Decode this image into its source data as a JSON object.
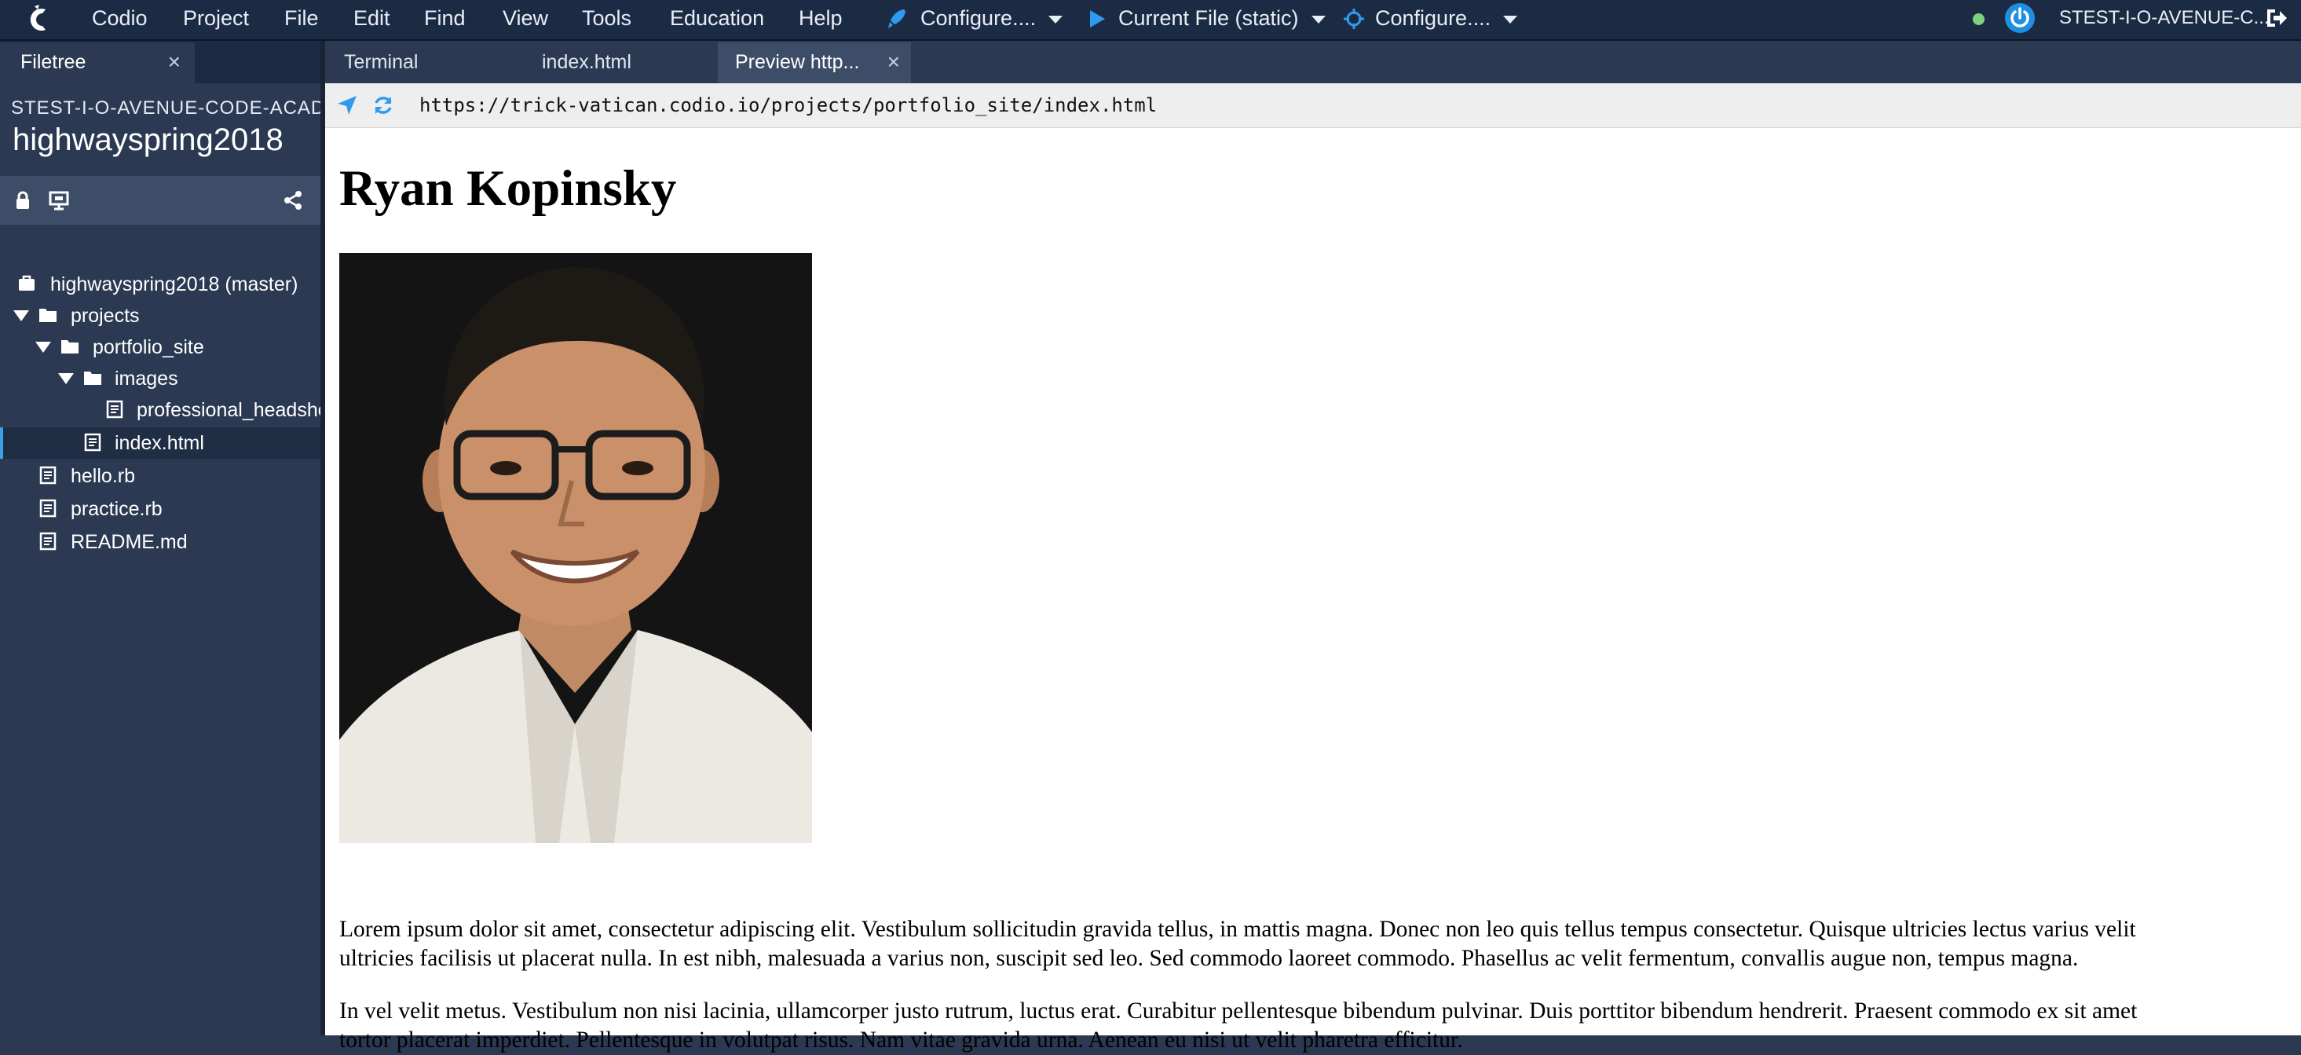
{
  "menubar": {
    "items": [
      "Codio",
      "Project",
      "File",
      "Edit",
      "Find",
      "View",
      "Tools",
      "Education",
      "Help"
    ],
    "configure_deploy": "Configure....",
    "run_target": "Current File (static)",
    "configure_preview": "Configure....",
    "user": "STEST-I-O-AVENUE-C...",
    "status_color": "#7ed27e",
    "accent_color": "#1f8fe0"
  },
  "sidebar": {
    "tab_label": "Filetree",
    "close_glyph": "×",
    "owner": "STEST-I-O-AVENUE-CODE-ACADEM",
    "project_name": "highwayspring2018",
    "tree": [
      {
        "label": "highwayspring2018 (master)",
        "icon": "briefcase-icon"
      },
      {
        "label": "projects",
        "icon": "folder-icon",
        "expanded": true
      },
      {
        "label": "portfolio_site",
        "icon": "folder-icon",
        "expanded": true
      },
      {
        "label": "images",
        "icon": "folder-icon",
        "expanded": true
      },
      {
        "label": "professional_headshot",
        "icon": "file-icon"
      },
      {
        "label": "index.html",
        "icon": "file-icon",
        "selected": true
      },
      {
        "label": "hello.rb",
        "icon": "file-icon"
      },
      {
        "label": "practice.rb",
        "icon": "file-icon"
      },
      {
        "label": "README.md",
        "icon": "file-icon"
      }
    ]
  },
  "tabs": [
    {
      "label": "Terminal"
    },
    {
      "label": "index.html"
    },
    {
      "label": "Preview http...",
      "active": true,
      "close": "×"
    }
  ],
  "preview": {
    "url": "https://trick-vatican.codio.io/projects/portfolio_site/index.html",
    "heading": "Ryan Kopinsky",
    "paragraph1_line1": "Lorem ipsum dolor sit amet, consectetur adipiscing elit. Vestibulum sollicitudin gravida tellus, in mattis magna. Donec non leo quis tellus tempus consectetur. Quisque ultricies lectus varius velit",
    "paragraph1_line2": "ultricies facilisis ut placerat nulla. In est nibh, malesuada a varius non, suscipit sed leo. Sed commodo laoreet commodo. Phasellus ac velit fermentum, convallis augue non, tempus magna.",
    "paragraph2_line1": "In vel velit metus. Vestibulum non nisi lacinia, ullamcorper justo rutrum, luctus erat. Curabitur pellentesque bibendum pulvinar. Duis porttitor bibendum hendrerit. Praesent commodo ex sit amet",
    "paragraph2_line2": "tortor placerat imperdiet. Pellentesque in volutpat risus. Nam vitae gravida urna. Aenean eu nisi ut velit pharetra efficitur."
  }
}
